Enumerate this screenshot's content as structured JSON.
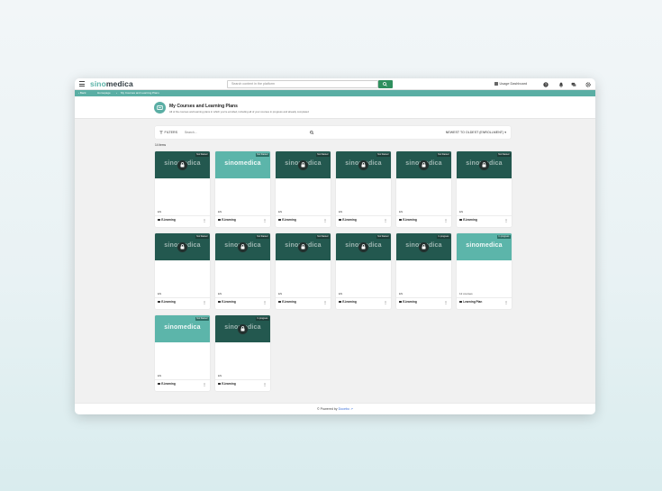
{
  "topbar": {
    "logo_part1": "sino",
    "logo_part2": "medica",
    "search_placeholder": "Search content in the platform",
    "usage_label": "Usage Dashboard"
  },
  "breadcrumb": {
    "back": "‹ Back",
    "home": "Homepage",
    "sep": "›",
    "current": "My Courses and Learning Plans"
  },
  "header": {
    "title": "My Courses and Learning Plans",
    "subtitle": "All of the courses and learning plans in which you're enrolled, including all of your courses in progress and already completed"
  },
  "filterbar": {
    "filters_label": "FILTERS",
    "search_placeholder": "Search...",
    "sort_label": "NEWEST TO OLDEST (ENROLLMENT)",
    "sort_arrow": "▾"
  },
  "items_count": "14 items",
  "cards": [
    {
      "thumb": "dark",
      "badge": "Not Started",
      "locked": true,
      "watermark": "sinomedica",
      "lang": "EN",
      "type": "E-learning"
    },
    {
      "thumb": "light",
      "badge": "Not Started",
      "locked": false,
      "watermark": "sinomedica",
      "lang": "EN",
      "type": "E-learning"
    },
    {
      "thumb": "dark",
      "badge": "Not Started",
      "locked": true,
      "watermark": "sinomedica",
      "lang": "EN",
      "type": "E-learning"
    },
    {
      "thumb": "dark",
      "badge": "Not Started",
      "locked": true,
      "watermark": "sinomedica",
      "lang": "EN",
      "type": "E-learning"
    },
    {
      "thumb": "dark",
      "badge": "Not Started",
      "locked": true,
      "watermark": "sinomedica",
      "lang": "EN",
      "type": "E-learning"
    },
    {
      "thumb": "dark",
      "badge": "Not Started",
      "locked": true,
      "watermark": "sinomedica",
      "lang": "EN",
      "type": "E-learning"
    },
    {
      "thumb": "dark",
      "badge": "Not Started",
      "locked": true,
      "watermark": "sinomedica",
      "lang": "EN",
      "type": "E-learning"
    },
    {
      "thumb": "dark",
      "badge": "Not Started",
      "locked": true,
      "watermark": "sinomedica",
      "lang": "EN",
      "type": "E-learning"
    },
    {
      "thumb": "dark",
      "badge": "Not Started",
      "locked": true,
      "watermark": "sinomedica",
      "lang": "EN",
      "type": "E-learning"
    },
    {
      "thumb": "dark",
      "badge": "Not Started",
      "locked": true,
      "watermark": "sinomedica",
      "lang": "EN",
      "type": "E-learning"
    },
    {
      "thumb": "dark",
      "badge": "In progress",
      "locked": true,
      "watermark": "sinomedica",
      "lang": "EN",
      "type": "E-learning"
    },
    {
      "thumb": "light",
      "badge": "In progress",
      "locked": false,
      "watermark": "sinomedica",
      "lang": "12 courses",
      "type": "Learning Plan"
    },
    {
      "thumb": "light",
      "badge": "Not Started",
      "locked": false,
      "watermark": "sinomedica",
      "lang": "EN",
      "type": "E-learning"
    },
    {
      "thumb": "dark",
      "badge": "In progress",
      "locked": true,
      "watermark": "sinomedica",
      "lang": "EN",
      "type": "E-learning"
    }
  ],
  "footer": {
    "powered_by": "© Powered by",
    "brand": "Docebo"
  },
  "colors": {
    "accent": "#5aaea4",
    "thumb_dark": "#23584f",
    "thumb_light": "#5cb5aa",
    "search_button": "#2f8f5e"
  }
}
